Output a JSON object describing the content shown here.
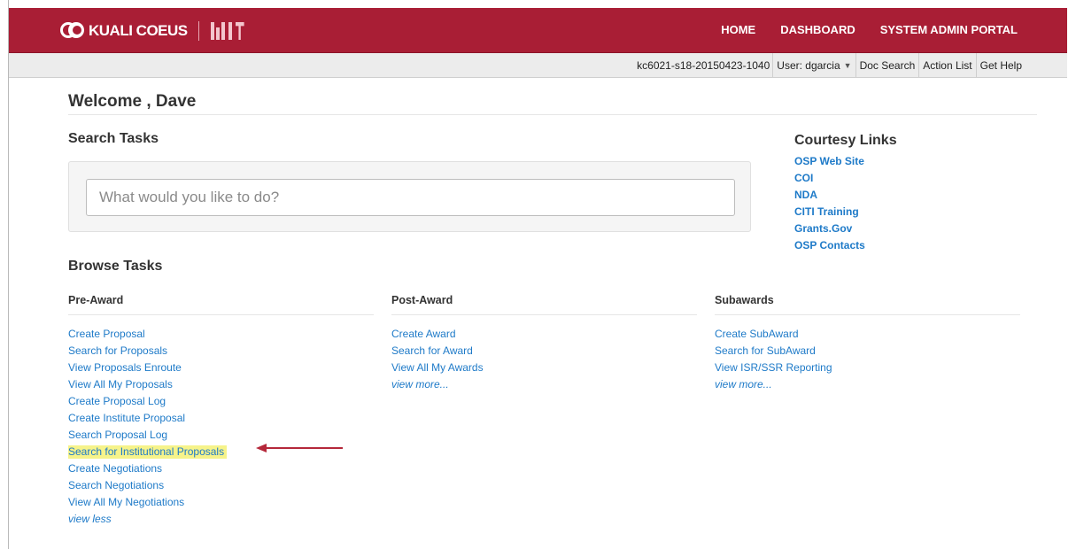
{
  "header": {
    "logo_text": "KUALI COEUS",
    "nav": [
      "HOME",
      "DASHBOARD",
      "SYSTEM ADMIN PORTAL"
    ],
    "brand_color": "#a91e35"
  },
  "subbar": {
    "environment": "kc6021-s18-20150423-1040",
    "user_label": "User: dgarcia",
    "links": [
      "Doc Search",
      "Action List",
      "Get Help"
    ]
  },
  "welcome": "Welcome , Dave",
  "search": {
    "heading": "Search Tasks",
    "placeholder": "What would you like to do?"
  },
  "courtesy": {
    "heading": "Courtesy Links",
    "links": [
      "OSP Web Site",
      "COI",
      "NDA",
      "CITI Training",
      "Grants.Gov",
      "OSP Contacts"
    ]
  },
  "browse": {
    "heading": "Browse Tasks",
    "columns": [
      {
        "title": "Pre-Award",
        "links": [
          "Create Proposal",
          "Search for Proposals",
          "View Proposals Enroute",
          "View All My Proposals",
          "Create Proposal Log",
          "Create Institute Proposal",
          "Search Proposal Log",
          "Search for Institutional Proposals",
          "Create Negotiations",
          "Search Negotiations",
          "View All My Negotiations"
        ],
        "toggle": "view less"
      },
      {
        "title": "Post-Award",
        "links": [
          "Create Award",
          "Search for Award",
          "View All My Awards"
        ],
        "toggle": "view more..."
      },
      {
        "title": "Subawards",
        "links": [
          "Create SubAward",
          "Search for SubAward",
          "View ISR/SSR Reporting"
        ],
        "toggle": "view more..."
      }
    ]
  },
  "annotation": {
    "highlight_color": "#f6f38a",
    "arrow_color": "#b5283a"
  }
}
